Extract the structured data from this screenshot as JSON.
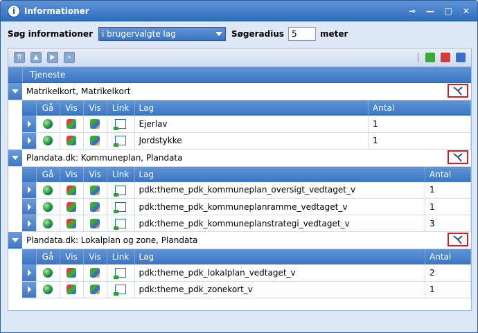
{
  "window": {
    "title": "Informationer",
    "icon": "info-icon"
  },
  "search": {
    "label": "Søg informationer",
    "scope_value": "i brugervalgte lag",
    "radius_label": "Søgeradius",
    "radius_value": "5",
    "unit_label": "meter"
  },
  "grid": {
    "header": "Tjeneste"
  },
  "columns": {
    "ga": "Gå",
    "vis1": "Vis",
    "vis2": "Vis",
    "link": "Link",
    "lag": "Lag",
    "antal": "Antal"
  },
  "groups": [
    {
      "name": "Matrikelkort, Matrikelkort",
      "rows": [
        {
          "lag": "Ejerlav",
          "antal": "1"
        },
        {
          "lag": "Jordstykke",
          "antal": "1"
        }
      ]
    },
    {
      "name": "Plandata.dk: Kommuneplan, Plandata",
      "rows": [
        {
          "lag": "pdk:theme_pdk_kommuneplan_oversigt_vedtaget_v",
          "antal": "1"
        },
        {
          "lag": "pdk:theme_pdk_kommuneplanramme_vedtaget_v",
          "antal": "1"
        },
        {
          "lag": "pdk:theme_pdk_kommuneplanstrategi_vedtaget_v",
          "antal": "3"
        }
      ]
    },
    {
      "name": "Plandata.dk: Lokalplan og zone, Plandata",
      "rows": [
        {
          "lag": "pdk:theme_pdk_lokalplan_vedtaget_v",
          "antal": "2"
        },
        {
          "lag": "pdk:theme_pdk_zonekort_v",
          "antal": "1"
        }
      ]
    }
  ]
}
